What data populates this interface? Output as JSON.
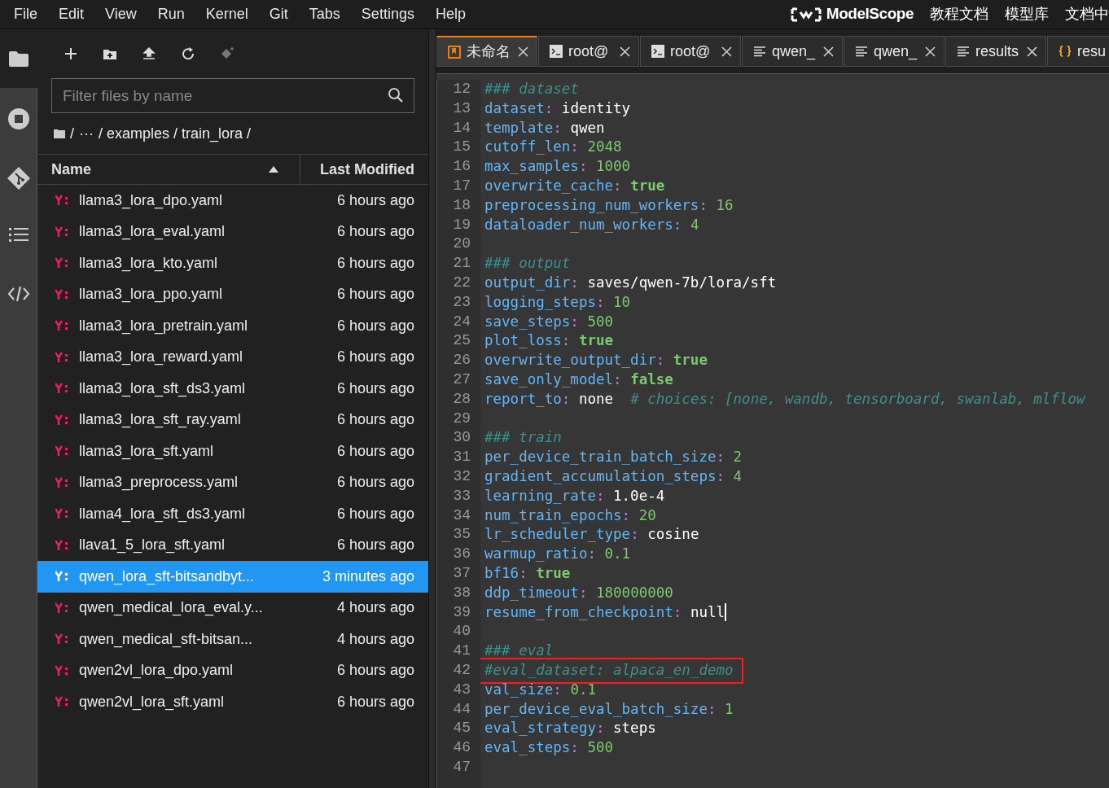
{
  "menu": [
    "File",
    "Edit",
    "View",
    "Run",
    "Kernel",
    "Git",
    "Tabs",
    "Settings",
    "Help"
  ],
  "brand": {
    "name": "ModelScope",
    "links": [
      "教程文档",
      "模型库",
      "文档中"
    ]
  },
  "filter": {
    "placeholder": "Filter files by name"
  },
  "breadcrumb": [
    "/",
    "···",
    "/ examples / train_lora /"
  ],
  "file_table": {
    "columns": [
      "Name",
      "Last Modified"
    ],
    "rows": [
      {
        "name": "llama3_lora_dpo.yaml",
        "modified": "6 hours ago",
        "selected": false
      },
      {
        "name": "llama3_lora_eval.yaml",
        "modified": "6 hours ago",
        "selected": false
      },
      {
        "name": "llama3_lora_kto.yaml",
        "modified": "6 hours ago",
        "selected": false
      },
      {
        "name": "llama3_lora_ppo.yaml",
        "modified": "6 hours ago",
        "selected": false
      },
      {
        "name": "llama3_lora_pretrain.yaml",
        "modified": "6 hours ago",
        "selected": false
      },
      {
        "name": "llama3_lora_reward.yaml",
        "modified": "6 hours ago",
        "selected": false
      },
      {
        "name": "llama3_lora_sft_ds3.yaml",
        "modified": "6 hours ago",
        "selected": false
      },
      {
        "name": "llama3_lora_sft_ray.yaml",
        "modified": "6 hours ago",
        "selected": false
      },
      {
        "name": "llama3_lora_sft.yaml",
        "modified": "6 hours ago",
        "selected": false
      },
      {
        "name": "llama3_preprocess.yaml",
        "modified": "6 hours ago",
        "selected": false
      },
      {
        "name": "llama4_lora_sft_ds3.yaml",
        "modified": "6 hours ago",
        "selected": false
      },
      {
        "name": "llava1_5_lora_sft.yaml",
        "modified": "6 hours ago",
        "selected": false
      },
      {
        "name": "qwen_lora_sft-bitsandbyt...",
        "modified": "3 minutes ago",
        "selected": true
      },
      {
        "name": "qwen_medical_lora_eval.y...",
        "modified": "4 hours ago",
        "selected": false
      },
      {
        "name": "qwen_medical_sft-bitsan...",
        "modified": "4 hours ago",
        "selected": false
      },
      {
        "name": "qwen2vl_lora_dpo.yaml",
        "modified": "6 hours ago",
        "selected": false
      },
      {
        "name": "qwen2vl_lora_sft.yaml",
        "modified": "6 hours ago",
        "selected": false
      }
    ]
  },
  "tabs": [
    {
      "kind": "notebook",
      "label": "未命名",
      "selected": true
    },
    {
      "kind": "terminal",
      "label": "root@",
      "selected": false
    },
    {
      "kind": "terminal",
      "label": "root@",
      "selected": false
    },
    {
      "kind": "text",
      "label": "qwen_",
      "selected": false
    },
    {
      "kind": "text",
      "label": "qwen_",
      "selected": false
    },
    {
      "kind": "text",
      "label": "results",
      "selected": false
    },
    {
      "kind": "json",
      "label": "resu",
      "selected": false
    }
  ],
  "editor": {
    "lines": [
      {
        "n": "12",
        "tokens": [
          {
            "kind": "comment",
            "text": "### dataset"
          }
        ]
      },
      {
        "n": "13",
        "tokens": [
          {
            "kind": "key",
            "text": "dataset"
          },
          {
            "kind": "colon",
            "text": ":"
          },
          {
            "kind": "string",
            "text": " identity"
          }
        ]
      },
      {
        "n": "14",
        "tokens": [
          {
            "kind": "key",
            "text": "template"
          },
          {
            "kind": "colon",
            "text": ":"
          },
          {
            "kind": "string",
            "text": " qwen"
          }
        ]
      },
      {
        "n": "15",
        "tokens": [
          {
            "kind": "key",
            "text": "cutoff_len"
          },
          {
            "kind": "colon",
            "text": ":"
          },
          {
            "kind": "number",
            "text": " 2048"
          }
        ]
      },
      {
        "n": "16",
        "tokens": [
          {
            "kind": "key",
            "text": "max_samples"
          },
          {
            "kind": "colon",
            "text": ":"
          },
          {
            "kind": "number",
            "text": " 1000"
          }
        ]
      },
      {
        "n": "17",
        "tokens": [
          {
            "kind": "key",
            "text": "overwrite_cache"
          },
          {
            "kind": "colon",
            "text": ":"
          },
          {
            "kind": "bool",
            "text": " true"
          }
        ]
      },
      {
        "n": "18",
        "tokens": [
          {
            "kind": "key",
            "text": "preprocessing_num_workers"
          },
          {
            "kind": "colon",
            "text": ":"
          },
          {
            "kind": "number",
            "text": " 16"
          }
        ]
      },
      {
        "n": "19",
        "tokens": [
          {
            "kind": "key",
            "text": "dataloader_num_workers"
          },
          {
            "kind": "colon",
            "text": ":"
          },
          {
            "kind": "number",
            "text": " 4"
          }
        ]
      },
      {
        "n": "20"
      },
      {
        "n": "21",
        "tokens": [
          {
            "kind": "comment",
            "text": "### output"
          }
        ]
      },
      {
        "n": "22",
        "tokens": [
          {
            "kind": "key",
            "text": "output_dir"
          },
          {
            "kind": "colon",
            "text": ":"
          },
          {
            "kind": "string",
            "text": " saves/qwen-7b/lora/sft"
          }
        ]
      },
      {
        "n": "23",
        "tokens": [
          {
            "kind": "key",
            "text": "logging_steps"
          },
          {
            "kind": "colon",
            "text": ":"
          },
          {
            "kind": "number",
            "text": " 10"
          }
        ]
      },
      {
        "n": "24",
        "tokens": [
          {
            "kind": "key",
            "text": "save_steps"
          },
          {
            "kind": "colon",
            "text": ":"
          },
          {
            "kind": "number",
            "text": " 500"
          }
        ]
      },
      {
        "n": "25",
        "tokens": [
          {
            "kind": "key",
            "text": "plot_loss"
          },
          {
            "kind": "colon",
            "text": ":"
          },
          {
            "kind": "bool",
            "text": " true"
          }
        ]
      },
      {
        "n": "26",
        "tokens": [
          {
            "kind": "key",
            "text": "overwrite_output_dir"
          },
          {
            "kind": "colon",
            "text": ":"
          },
          {
            "kind": "bool",
            "text": " true"
          }
        ]
      },
      {
        "n": "27",
        "tokens": [
          {
            "kind": "key",
            "text": "save_only_model"
          },
          {
            "kind": "colon",
            "text": ":"
          },
          {
            "kind": "bool",
            "text": " false"
          }
        ]
      },
      {
        "n": "28",
        "tokens": [
          {
            "kind": "key",
            "text": "report_to"
          },
          {
            "kind": "colon",
            "text": ":"
          },
          {
            "kind": "string",
            "text": " none  "
          },
          {
            "kind": "comment",
            "text": "# choices: [none, wandb, tensorboard, swanlab, mlflow"
          }
        ]
      },
      {
        "n": "29"
      },
      {
        "n": "30",
        "tokens": [
          {
            "kind": "comment",
            "text": "### train"
          }
        ]
      },
      {
        "n": "31",
        "tokens": [
          {
            "kind": "key",
            "text": "per_device_train_batch_size"
          },
          {
            "kind": "colon",
            "text": ":"
          },
          {
            "kind": "number",
            "text": " 2"
          }
        ]
      },
      {
        "n": "32",
        "tokens": [
          {
            "kind": "key",
            "text": "gradient_accumulation_steps"
          },
          {
            "kind": "colon",
            "text": ":"
          },
          {
            "kind": "number",
            "text": " 4"
          }
        ]
      },
      {
        "n": "33",
        "tokens": [
          {
            "kind": "key",
            "text": "learning_rate"
          },
          {
            "kind": "colon",
            "text": ":"
          },
          {
            "kind": "string",
            "text": " 1.0e-4"
          }
        ]
      },
      {
        "n": "34",
        "tokens": [
          {
            "kind": "key",
            "text": "num_train_epochs"
          },
          {
            "kind": "colon",
            "text": ":"
          },
          {
            "kind": "number",
            "text": " 20"
          }
        ]
      },
      {
        "n": "35",
        "tokens": [
          {
            "kind": "key",
            "text": "lr_scheduler_type"
          },
          {
            "kind": "colon",
            "text": ":"
          },
          {
            "kind": "string",
            "text": " cosine"
          }
        ]
      },
      {
        "n": "36",
        "tokens": [
          {
            "kind": "key",
            "text": "warmup_ratio"
          },
          {
            "kind": "colon",
            "text": ":"
          },
          {
            "kind": "number",
            "text": " 0.1"
          }
        ]
      },
      {
        "n": "37",
        "tokens": [
          {
            "kind": "key",
            "text": "bf16"
          },
          {
            "kind": "colon",
            "text": ":"
          },
          {
            "kind": "bool",
            "text": " true"
          }
        ]
      },
      {
        "n": "38",
        "tokens": [
          {
            "kind": "key",
            "text": "ddp_timeout"
          },
          {
            "kind": "colon",
            "text": ":"
          },
          {
            "kind": "number",
            "text": " 180000000"
          }
        ]
      },
      {
        "n": "39",
        "cursor": true,
        "tokens": [
          {
            "kind": "key",
            "text": "resume_from_checkpoint"
          },
          {
            "kind": "colon",
            "text": ":"
          },
          {
            "kind": "string",
            "text": " null"
          }
        ]
      },
      {
        "n": "40"
      },
      {
        "n": "41",
        "tokens": [
          {
            "kind": "comment",
            "text": "### eval"
          }
        ]
      },
      {
        "n": "42",
        "highlighted": true,
        "tokens": [
          {
            "kind": "comment",
            "text": "#eval_dataset: alpaca_en_demo"
          }
        ]
      },
      {
        "n": "43",
        "tokens": [
          {
            "kind": "key",
            "text": "val_size"
          },
          {
            "kind": "colon",
            "text": ":"
          },
          {
            "kind": "number",
            "text": " 0.1"
          }
        ]
      },
      {
        "n": "44",
        "tokens": [
          {
            "kind": "key",
            "text": "per_device_eval_batch_size"
          },
          {
            "kind": "colon",
            "text": ":"
          },
          {
            "kind": "number",
            "text": " 1"
          }
        ]
      },
      {
        "n": "45",
        "tokens": [
          {
            "kind": "key",
            "text": "eval_strategy"
          },
          {
            "kind": "colon",
            "text": ":"
          },
          {
            "kind": "string",
            "text": " steps"
          }
        ]
      },
      {
        "n": "46",
        "tokens": [
          {
            "kind": "key",
            "text": "eval_steps"
          },
          {
            "kind": "colon",
            "text": ":"
          },
          {
            "kind": "number",
            "text": " 500"
          }
        ]
      },
      {
        "n": "47"
      }
    ]
  }
}
